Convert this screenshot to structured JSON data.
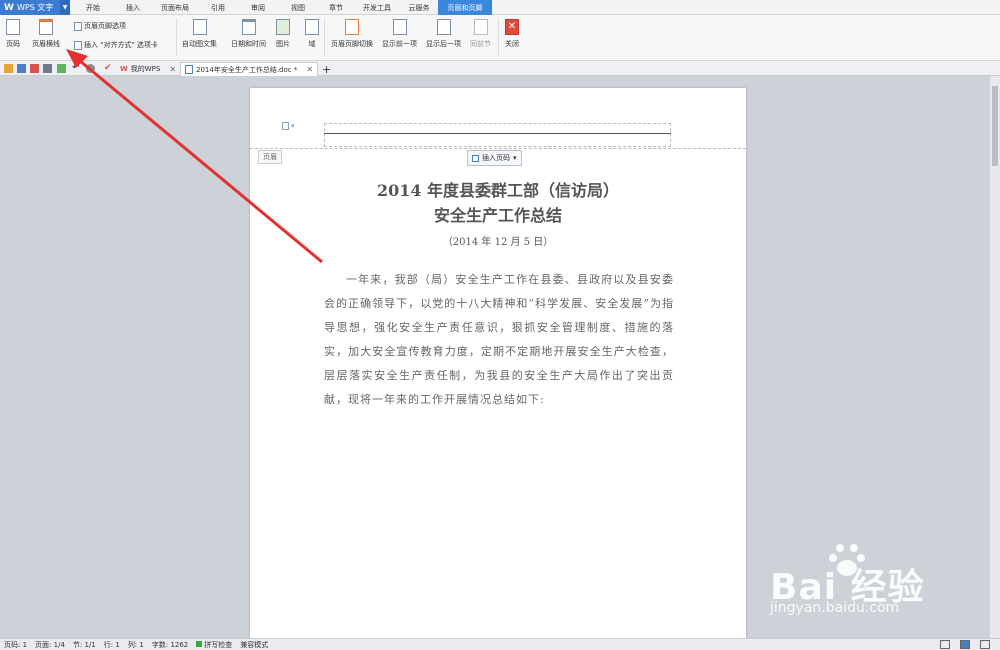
{
  "app": {
    "name": "WPS 文字",
    "logo": "W"
  },
  "menu_tabs": [
    "开始",
    "插入",
    "页面布局",
    "引用",
    "审阅",
    "视图",
    "章节",
    "开发工具",
    "云服务",
    "页眉和页脚"
  ],
  "active_tab": "页眉和页脚",
  "ribbon": {
    "page_number": "页码",
    "header_line": "页眉横线",
    "header_footer_options": "页眉页脚选项",
    "insert_align_tab": "插入 \"对齐方式\" 选项卡",
    "auto_text": "自动图文集",
    "date_time": "日期和时间",
    "picture": "图片",
    "field": "域",
    "switch_header_footer": "页眉页脚切换",
    "show_previous": "显示前一项",
    "show_next": "显示后一项",
    "same_as_previous": "同前节",
    "close": "关闭"
  },
  "doc_tabs": {
    "my_wps": "我的WPS",
    "active_doc": "2014年安全生产工作总结.doc *"
  },
  "header_area": {
    "label": "页眉",
    "insert_page_number": "插入页码"
  },
  "document": {
    "title_line1": "2014 年度县委群工部（信访局）",
    "title_line2": "安全生产工作总结",
    "date": "（2014 年 12 月 5 日）",
    "body": "一年来，我部（局）安全生产工作在县委、县政府以及县安委会的正确领导下，以党的十八大精神和“科学发展、安全发展”为指导思想，强化安全生产责任意识，狠抓安全管理制度、措施的落实，加大安全宣传教育力度，定期不定期地开展安全生产大检查，层层落实安全生产责任制，为我县的安全生产大局作出了突出贡献，现将一年来的工作开展情况总结如下:"
  },
  "status_bar": {
    "page_num": "页码: 1",
    "pages": "页面: 1/4",
    "section": "节: 1/1",
    "row": "行: 1",
    "col": "列: 1",
    "word_count": "字数: 1262",
    "spell_check": "拼写检查",
    "compat_mode": "兼容模式"
  },
  "watermark": {
    "logo": "Bai 经验",
    "url": "jingyan.baidu.com"
  },
  "colors": {
    "accent": "#3a87dc",
    "arrow": "#e53030"
  }
}
